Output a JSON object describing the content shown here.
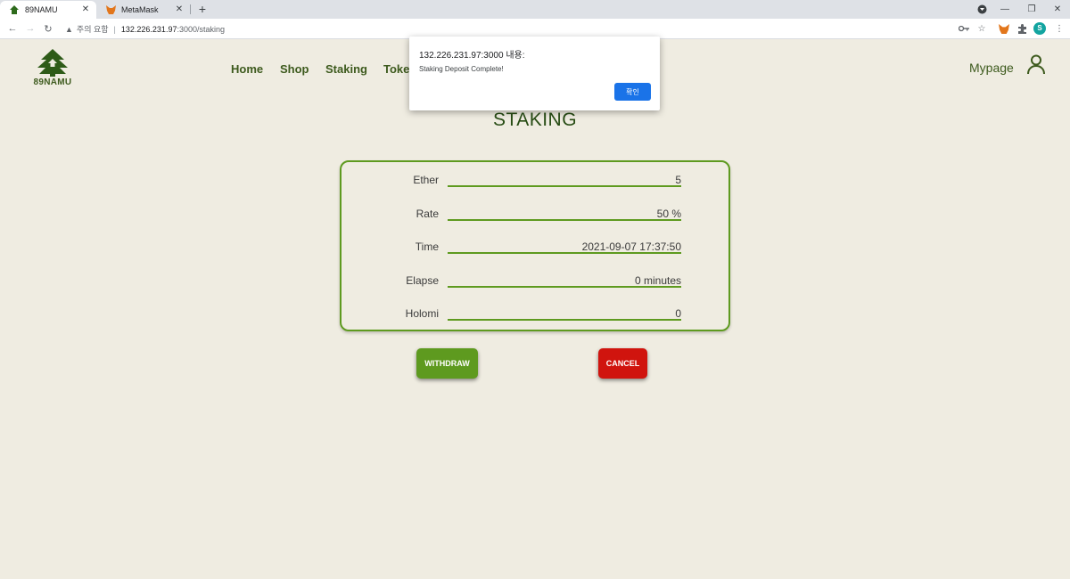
{
  "browser": {
    "tabs": [
      {
        "title": "89NAMU",
        "icon": "tree-icon",
        "active": true
      },
      {
        "title": "MetaMask",
        "icon": "fox-icon",
        "active": false
      }
    ],
    "address": {
      "warning": "주의 요함",
      "host": "132.226.231.97",
      "path": ":3000/staking"
    },
    "profile_initial": "S"
  },
  "site": {
    "logo_text": "89NAMU",
    "nav": [
      "Home",
      "Shop",
      "Staking",
      "Token"
    ],
    "mypage_label": "Mypage",
    "title": "STAKING"
  },
  "staking": {
    "rows": [
      {
        "label": "Ether",
        "value": "5"
      },
      {
        "label": "Rate",
        "value": "50 %"
      },
      {
        "label": "Time",
        "value": "2021-09-07 17:37:50"
      },
      {
        "label": "Elapse",
        "value": "0 minutes"
      },
      {
        "label": "Holomi",
        "value": "0"
      }
    ],
    "withdraw_label": "WITHDRAW",
    "cancel_label": "CANCEL"
  },
  "dialog": {
    "title": "132.226.231.97:3000 내용:",
    "message": "Staking Deposit Complete!",
    "ok_label": "확인"
  },
  "colors": {
    "brand_green": "#5e9a1f",
    "text_green": "#3d5a1d",
    "background": "#efece1",
    "cancel_red": "#d0140e",
    "dialog_button": "#1a73e8"
  }
}
